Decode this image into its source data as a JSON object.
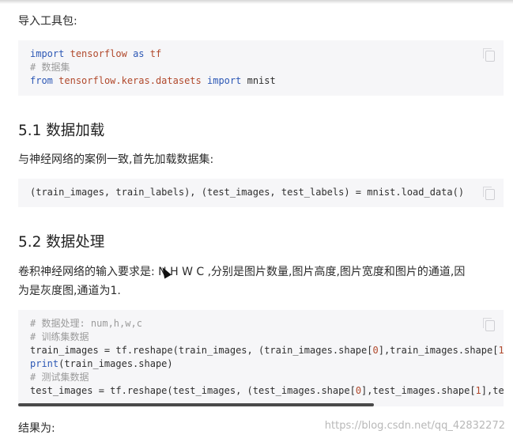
{
  "intro_label": "导入工具包:",
  "code1": {
    "line1": {
      "kw1": "import",
      "mod": "tensorflow",
      "kw2": "as",
      "alias": "tf"
    },
    "line2": "# 数据集",
    "line3": {
      "kw1": "from",
      "mod": "tensorflow.keras.datasets",
      "kw2": "import",
      "rest": "mnist"
    }
  },
  "section1": {
    "heading": "5.1 数据加载",
    "text": "与神经网络的案例一致,首先加载数据集:"
  },
  "code2": "(train_images, train_labels), (test_images, test_labels) = mnist.load_data()",
  "section2": {
    "heading": "5.2 数据处理",
    "text_line1": "卷积神经网络的输入要求是: N H W C ,分别是图片数量,图片高度,图片宽度和图片的通道,因",
    "text_line2": "为是灰度图,通道为1."
  },
  "code3": {
    "c1": "# 数据处理: num,h,w,c",
    "c2": "# 训练集数据",
    "l3a": "train_images = tf.reshape(train_images, (train_images.shape[",
    "l3n": "0",
    "l3b": "],train_images.shape[",
    "l3n2": "1",
    "l4fn": "print",
    "l4rest": "(train_images.shape)",
    "c5": "# 测试集数据",
    "l6a": "test_images = tf.reshape(test_images, (test_images.shape[",
    "l6n": "0",
    "l6b": "],test_images.shape[",
    "l6n2": "1",
    "l6c": "],te"
  },
  "result_label": "结果为:",
  "watermark": "https://blog.csdn.net/qq_42832272",
  "icons": [
    "copy-icon",
    "mouse-cursor-icon"
  ],
  "colors": {
    "code_bg": "#f6f6f8",
    "keyword": "#2d58b5",
    "module": "#b1492c",
    "comment": "#9a9a9a"
  }
}
